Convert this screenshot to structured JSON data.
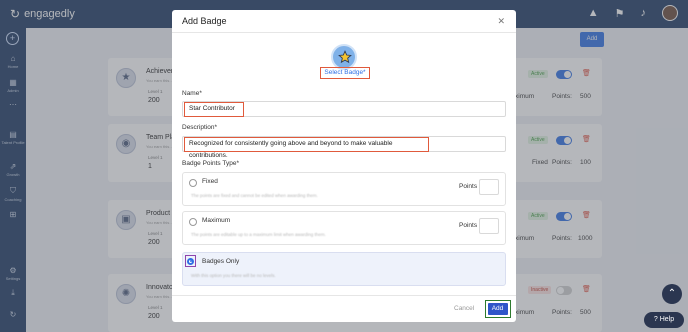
{
  "app": {
    "logo_text": "engagedly"
  },
  "sidebar": {
    "items": [
      {
        "label": "Home"
      },
      {
        "label": "Admin"
      },
      {
        "label": "Talent Profile"
      },
      {
        "label": "Growth"
      },
      {
        "label": "Coaching"
      },
      {
        "label": "Settings"
      }
    ]
  },
  "page": {
    "add_label": "Add",
    "cards": [
      {
        "name": "Achiever",
        "sub": "You earn this…",
        "level_label": "Level 1",
        "level_value": "200",
        "status": "Active",
        "metric_label": "Maximum",
        "points_label": "Points:",
        "points_value": "500"
      },
      {
        "name": "Team Pla",
        "sub": "You earn this…",
        "level_label": "Level 1",
        "level_value": "1",
        "status": "Active",
        "metric_label": "Fixed",
        "points_label": "Points:",
        "points_value": "100"
      },
      {
        "name": "Product C",
        "sub": "You earn this…",
        "level_label": "Level 1",
        "level_value": "200",
        "status": "Active",
        "metric_label": "Maximum",
        "points_label": "Points:",
        "points_value": "1000"
      },
      {
        "name": "Innovato",
        "sub": "You earn this…",
        "level_label": "Level 1",
        "level_value": "200",
        "status": "Inactive",
        "metric_label": "Maximum",
        "points_label": "Points:",
        "points_value": "500"
      }
    ]
  },
  "modal": {
    "title": "Add Badge",
    "select_badge": "Select Badge*",
    "name_label": "Name*",
    "name_value": "Star Contributor",
    "description_label": "Description*",
    "description_value": "Recognized for consistently going above and beyond to make valuable contributions.",
    "points_type_label": "Badge Points Type*",
    "options": [
      {
        "title": "Fixed",
        "desc": "The points are fixed and cannot be edited when awarding them.",
        "points_label": "Points"
      },
      {
        "title": "Maximum",
        "desc": "The points are editable up to a maximum limit when awarding them.",
        "points_label": "Points"
      },
      {
        "title": "Badges Only",
        "desc": "With this option you there will be no levels."
      }
    ],
    "cancel_label": "Cancel",
    "add_label": "Add"
  },
  "help": {
    "label": "Help"
  },
  "colors": {
    "primary": "#2f6fe4",
    "nav": "#1e3a63",
    "highlight": "#e05a3c"
  }
}
